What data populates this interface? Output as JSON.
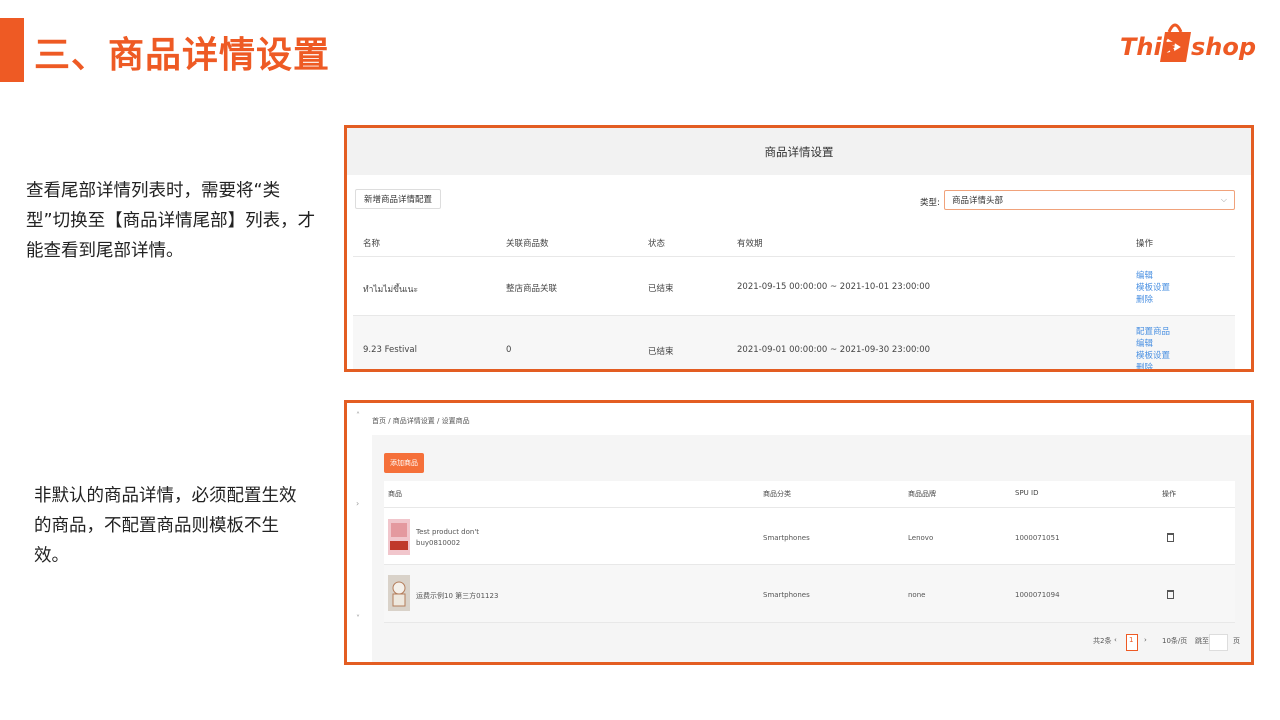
{
  "slide": {
    "title": "三、商品详情设置",
    "logo": {
      "left": "This",
      "right": "shop"
    },
    "note1": "查看尾部详情列表时，需要将“类型”切换至【商品详情尾部】列表，才能查看到尾部详情。",
    "note2": "非默认的商品详情，必须配置生效的商品，不配置商品则模板不生效。"
  },
  "shot1": {
    "page_title": "商品详情设置",
    "add_button": "新增商品详情配置",
    "type_label": "类型:",
    "type_value": "商品详情头部",
    "columns": [
      "名称",
      "关联商品数",
      "状态",
      "有效期",
      "操作"
    ],
    "rows": [
      {
        "name": "ทำไมไม่ขึ้นเนะ",
        "count": "整店商品关联",
        "status": "已结束",
        "validity": "2021-09-15 00:00:00 ~ 2021-10-01 23:00:00",
        "actions": [
          "编辑",
          "模板设置",
          "删除"
        ]
      },
      {
        "name": "9.23 Festival",
        "count": "0",
        "status": "已结束",
        "validity": "2021-09-01 00:00:00 ~ 2021-09-30 23:00:00",
        "actions": [
          "配置商品",
          "编辑",
          "模板设置",
          "删除"
        ]
      }
    ]
  },
  "shot2": {
    "breadcrumb": "首页 / 商品详情设置 / 设置商品",
    "add_button": "添加商品",
    "columns": [
      "商品",
      "商品分类",
      "商品品牌",
      "SPU ID",
      "操作"
    ],
    "rows": [
      {
        "product": "Test product don't buy0810002",
        "category": "Smartphones",
        "brand": "Lenovo",
        "spu": "1000071051"
      },
      {
        "product": "运费示例10 第三方01123",
        "category": "Smartphones",
        "brand": "none",
        "spu": "1000071094"
      }
    ],
    "pager": {
      "total": "共2条",
      "current": "1",
      "size": "10条/页",
      "goto": "跳至",
      "page_unit": "页"
    }
  },
  "colors": {
    "accent": "#ee5a24",
    "frame": "#e35d22",
    "link": "#4a90e2"
  }
}
